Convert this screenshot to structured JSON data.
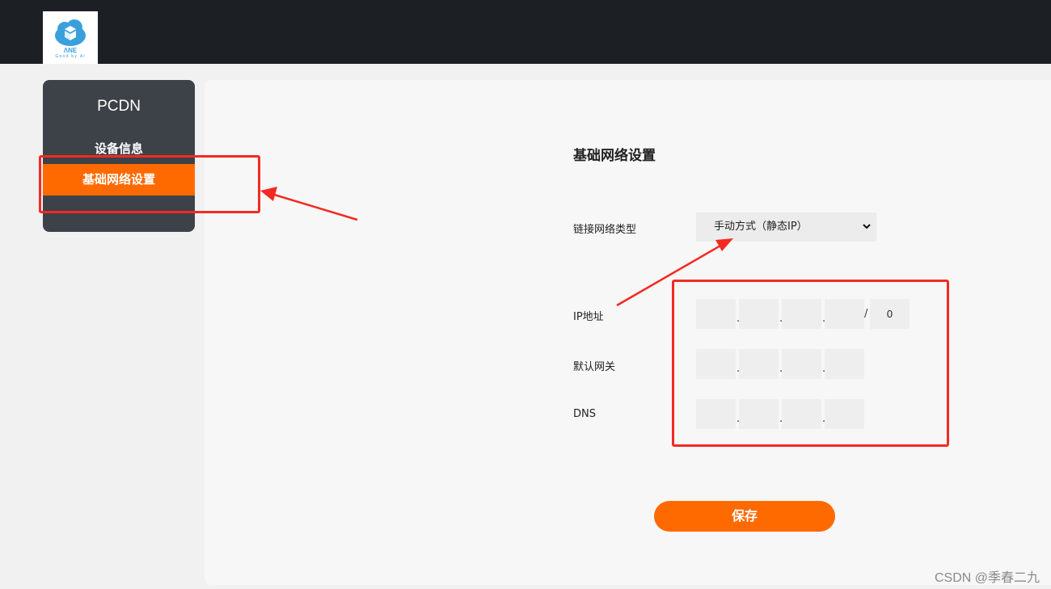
{
  "header": {
    "logo_text": "Good by Ai"
  },
  "sidebar": {
    "title": "PCDN",
    "items": [
      {
        "label": "设备信息",
        "active": false
      },
      {
        "label": "基础网络设置",
        "active": true
      }
    ]
  },
  "main": {
    "title": "基础网络设置",
    "link_type": {
      "label": "链接网络类型",
      "selected": "手动方式（静态IP）"
    },
    "ip": {
      "label": "IP地址",
      "octets": [
        "",
        "",
        "",
        ""
      ],
      "prefix": "0",
      "separator": "/"
    },
    "gateway": {
      "label": "默认网关",
      "octets": [
        "",
        "",
        "",
        ""
      ]
    },
    "dns": {
      "label": "DNS",
      "octets": [
        "",
        "",
        "",
        ""
      ]
    },
    "save_label": "保存"
  },
  "watermark": "CSDN @季春二九",
  "colors": {
    "accent": "#ff6a00",
    "sidebar_bg": "#3d4148",
    "topbar_bg": "#1c1f23",
    "annotation": "#f22a22"
  }
}
